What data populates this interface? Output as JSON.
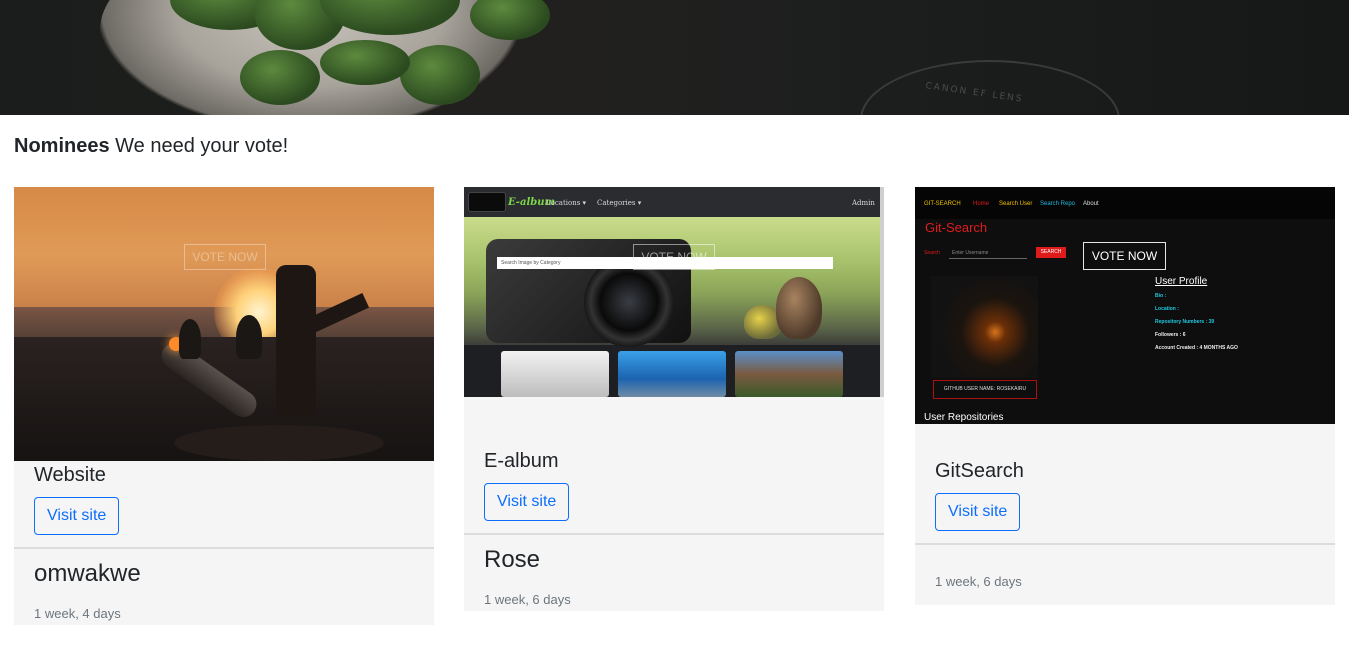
{
  "hero": {
    "lens_text": "CANON EF LENS"
  },
  "heading": {
    "bold": "Nominees",
    "rest": " We need your vote!"
  },
  "cards": [
    {
      "title": "Website",
      "button": "Visit site",
      "owner": "omwakwe",
      "time": "1 week, 4 days",
      "overlay_vote": "VOTE NOW"
    },
    {
      "title": "E-album",
      "button": "Visit site",
      "owner": "Rose",
      "time": "1 week, 6 days",
      "overlay_vote": "VOTE NOW",
      "screenshot": {
        "brand": "E-album",
        "nav_locations": "Locations ▾",
        "nav_categories": "Categories ▾",
        "nav_admin": "Admin",
        "search_placeholder": "Search Image by Category"
      }
    },
    {
      "title": "GitSearch",
      "button": "Visit site",
      "owner": "",
      "time": "1 week, 6 days",
      "screenshot": {
        "nav_brand": "GIT-SEARCH",
        "nav_home": "Home",
        "nav_search_user": "Search User",
        "nav_search_repo": "Search Repo",
        "nav_about": "About",
        "title": "Git-Search",
        "search_label": "Search",
        "search_placeholder": "Enter Username",
        "search_button": "SEARCH",
        "vote_button": "VOTE NOW",
        "profile_heading": "User Profile",
        "bio": "Bio :",
        "location": "Location :",
        "repo_numbers": "Repository Numbers :  39",
        "followers": "Followers :  6",
        "created": "Account Created :   4 MONTHS AGO",
        "github_label": "GITHUB USER NAME: ROSEKAIRU",
        "repos_heading": "User Repositories"
      }
    }
  ]
}
